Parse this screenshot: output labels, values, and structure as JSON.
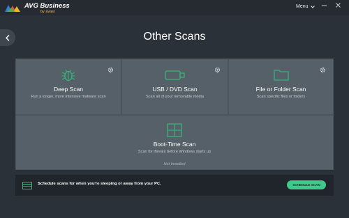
{
  "app": {
    "logo_text": "AVG Business",
    "logo_sub": "by avast",
    "menu_label": "Menu"
  },
  "page": {
    "title": "Other Scans"
  },
  "scans": [
    {
      "title": "Deep Scan",
      "desc": "Run a longer, more intensive malware scan",
      "icon": "bug-icon",
      "has_settings": true
    },
    {
      "title": "USB / DVD Scan",
      "desc": "Scan all of your removable media",
      "icon": "usb-drive-icon",
      "has_settings": true
    },
    {
      "title": "File or Folder Scan",
      "desc": "Scan specific files or folders",
      "icon": "folder-icon",
      "has_settings": true
    },
    {
      "title": "Boot-Time Scan",
      "desc": "Scan for threats before Windows starts up",
      "status": "Not Installed",
      "icon": "windows-icon",
      "has_settings": false
    }
  ],
  "schedule": {
    "text": "Schedule scans for when you're sleeping or away from your PC.",
    "button_label": "SCHEDULE SCAN",
    "icon": "calendar-icon"
  },
  "colors": {
    "accent": "#3fc98b",
    "icon_green": "#37b37a",
    "background": "#2b3138",
    "tile": "#566069"
  }
}
